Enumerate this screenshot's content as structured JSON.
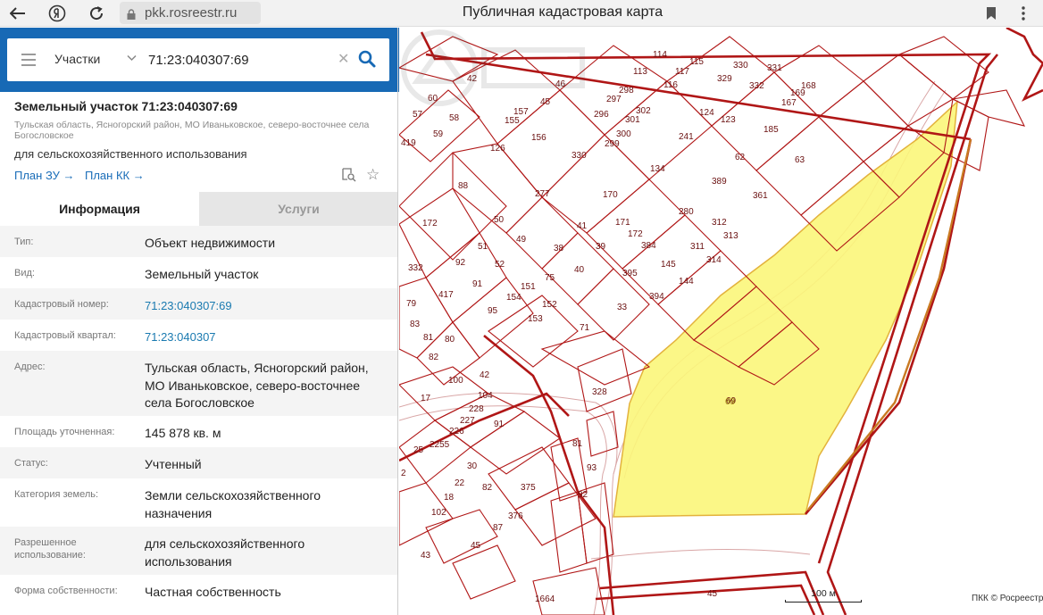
{
  "browser": {
    "url": "pkk.rosreestr.ru",
    "title": "Публичная кадастровая карта",
    "icons": [
      "back-arrow-icon",
      "yandex-icon",
      "reload-icon",
      "lock-icon",
      "bookmark-icon",
      "menu-icon"
    ]
  },
  "search": {
    "type_label": "Участки",
    "value": "71:23:040307:69",
    "colors": {
      "band": "#1769b5"
    }
  },
  "object": {
    "title": "Земельный участок 71:23:040307:69",
    "address_short": "Тульская область, Ясногорский район, МО Иваньковское, северо-восточнее села Богословское",
    "purpose": "для сельскохозяйственного использования",
    "plan_zu": "План ЗУ →",
    "plan_kk": "План КК →"
  },
  "tabs": {
    "info": "Информация",
    "services": "Услуги"
  },
  "info_rows": [
    {
      "label": "Тип:",
      "value": "Объект недвижимости"
    },
    {
      "label": "Вид:",
      "value": "Земельный участок"
    },
    {
      "label": "Кадастровый номер:",
      "value": "71:23:040307:69"
    },
    {
      "label": "Кадастровый квартал:",
      "value": "71:23:040307"
    },
    {
      "label": "Адрес:",
      "value": "Тульская область, Ясногорский район, МО Иваньковское, северо-восточнее села Богословское"
    },
    {
      "label": "Площадь уточненная:",
      "value": "145 878 кв. м"
    },
    {
      "label": "Статус:",
      "value": "Учтенный"
    },
    {
      "label": "Категория земель:",
      "value": "Земли сельскохозяйственного назначения"
    },
    {
      "label": "Разрешенное использование:",
      "value": "для сельскохозяйственного использования"
    },
    {
      "label": "Форма собственности:",
      "value": "Частная собственность"
    }
  ],
  "map": {
    "selected_parcel": "69",
    "scale_label": "100 м",
    "copyright": "ПКК © Росреестр",
    "colors": {
      "boundary": "#b01616",
      "selected_fill": "#fbf67a",
      "selected_stroke": "#e3b23c"
    },
    "parcel_labels": [
      "42",
      "45",
      "46",
      "60",
      "57",
      "58",
      "59",
      "419",
      "126",
      "155",
      "157",
      "156",
      "296",
      "297",
      "298",
      "302",
      "301",
      "299",
      "300",
      "113",
      "114",
      "115",
      "116",
      "117",
      "330",
      "331",
      "329",
      "332",
      "167",
      "169",
      "168",
      "124",
      "123",
      "241",
      "185",
      "62",
      "63",
      "330",
      "134",
      "389",
      "361",
      "88",
      "277",
      "170",
      "172",
      "171",
      "280",
      "311",
      "312",
      "313",
      "314",
      "172",
      "50",
      "51",
      "49",
      "52",
      "92",
      "91",
      "41",
      "38",
      "39",
      "40",
      "384",
      "395",
      "145",
      "144",
      "394",
      "332",
      "417",
      "75",
      "151",
      "154",
      "153",
      "152",
      "95",
      "33",
      "71",
      "79",
      "83",
      "81",
      "82",
      "80",
      "100",
      "42",
      "104",
      "228",
      "227",
      "17",
      "226",
      "2255",
      "25",
      "91",
      "328",
      "81",
      "93",
      "92",
      "69",
      "30",
      "22",
      "82",
      "18",
      "102",
      "375",
      "376",
      "87",
      "45",
      "43",
      "1664",
      "45",
      "2"
    ]
  }
}
